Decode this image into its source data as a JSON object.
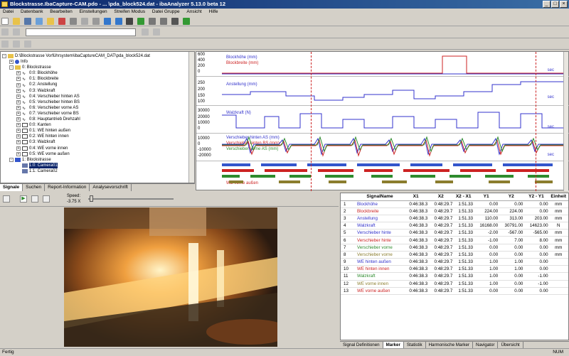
{
  "window": {
    "title": "Blockstrasse.IbaCapture-CAM.pdo - ... \\pda_block524.dat - ibaAnalyzer 5.13.0 beta 12"
  },
  "menu": [
    "Datei",
    "Datenbank",
    "Bearbeiten",
    "Einstellungen",
    "Streifen Modus",
    "Datei Gruppe",
    "Ansicht",
    "Hilfe"
  ],
  "tree": {
    "root": "D:\\Blockstrasse Vorführsystem\\ibaCaptureCAM_DAT\\pda_block524.dat",
    "items": [
      "Info",
      "0: Blockstrasse",
      "0:0: Blockhöhe",
      "0:1: Blockbreite",
      "0:2: Anstellung",
      "0:3: Walzkraft",
      "0:4: Verschieber hinten AS",
      "0:5: Verschieber hinten BS",
      "0:6: Verschieber vorne AS",
      "0:7: Verschieber vorne BS",
      "0:8: Hauptantrieb Drehzahl",
      "0:0: Kanten",
      "0:1: WE hinten außen",
      "0:2: WE hinten innen",
      "0:3: Walzkraft",
      "0:4: WE vorne innen",
      "0:5: WE vorne außen",
      "1: Blockstrasse",
      "1:0: Camera01",
      "1:1: Camera02"
    ]
  },
  "left_tabs": [
    "Signale",
    "Suchen",
    "Report-Information",
    "Analysevorschrift"
  ],
  "graphs": {
    "lanes": [
      {
        "y_ticks": [
          "600",
          "400",
          "200",
          "0"
        ],
        "signals": [
          "Blockhöhe (mm)",
          "Blockbreite (mm)"
        ],
        "unit": "sec"
      },
      {
        "y_ticks": [
          "250",
          "200",
          "150",
          "100"
        ],
        "signals": [
          "Anstellung (mm)"
        ],
        "unit": "sec"
      },
      {
        "y_ticks": [
          "30000",
          "20000",
          "10000",
          "0"
        ],
        "signals": [
          "Walzkraft (N)"
        ],
        "unit": "sec"
      },
      {
        "y_ticks": [
          "10000",
          "0",
          "-10000",
          "-20000"
        ],
        "signals": [
          "Verschieber hinten AS (mm)",
          "Verschieber hinten BS (mm)",
          "Verschieber vorne AS (mm)"
        ],
        "unit": "sec"
      },
      {
        "y_ticks": [],
        "signals": [
          "WE vorne außen"
        ],
        "unit": ""
      }
    ]
  },
  "player": {
    "speed_label": "Speed:",
    "speed_value": "-3.75 X"
  },
  "table": {
    "headers": [
      "",
      "SignalName",
      "X1",
      "X2",
      "X2 - X1",
      "Y1",
      "Y2",
      "Y2 - Y1",
      "Einheit"
    ],
    "rows": [
      [
        "1",
        "Blockhöhe",
        "0:46:38.3",
        "0:48:29.7",
        "1:51.33",
        "0.00",
        "0.00",
        "0.00",
        "mm",
        "#3333cc"
      ],
      [
        "2",
        "Blockbreite",
        "0:46:38.3",
        "0:48:29.7",
        "1:51.33",
        "224.00",
        "224.00",
        "0.00",
        "mm",
        "#cc2222"
      ],
      [
        "3",
        "Anstellung",
        "0:46:38.3",
        "0:48:29.7",
        "1:51.33",
        "110.00",
        "313.00",
        "203.00",
        "mm",
        "#3333cc"
      ],
      [
        "4",
        "Walzkraft",
        "0:46:38.3",
        "0:48:29.7",
        "1:51.33",
        "16168.00",
        "30791.00",
        "14623.00",
        "N",
        "#3333cc"
      ],
      [
        "5",
        "Verschieber hinte",
        "0:46:38.3",
        "0:48:29.7",
        "1:51.33",
        "-2.00",
        "-567.00",
        "-565.00",
        "mm",
        "#3333cc"
      ],
      [
        "6",
        "Verschieber hinte",
        "0:46:38.3",
        "0:48:29.7",
        "1:51.33",
        "-1.00",
        "7.00",
        "8.00",
        "mm",
        "#cc2222"
      ],
      [
        "7",
        "Verschieber vorne",
        "0:46:38.3",
        "0:48:29.7",
        "1:51.33",
        "0.00",
        "0.00",
        "0.00",
        "mm",
        "#2e8b2e"
      ],
      [
        "8",
        "Verschieber vorne",
        "0:46:38.3",
        "0:48:29.7",
        "1:51.33",
        "0.00",
        "0.00",
        "0.00",
        "mm",
        "#8b7d2e"
      ],
      [
        "9",
        "WE hinten außen",
        "0:46:38.3",
        "0:48:29.7",
        "1:51.33",
        "1.00",
        "1.00",
        "0.00",
        "",
        "#3333cc"
      ],
      [
        "10",
        "WE hinten innen",
        "0:46:38.3",
        "0:48:29.7",
        "1:51.33",
        "1.00",
        "1.00",
        "0.00",
        "",
        "#cc2222"
      ],
      [
        "11",
        "Walzkraft",
        "0:46:38.3",
        "0:48:29.7",
        "1:51.33",
        "1.00",
        "0.00",
        "-1.00",
        "",
        "#2e8b2e"
      ],
      [
        "12",
        "WE vorne innen",
        "0:46:38.3",
        "0:48:29.7",
        "1:51.33",
        "1.00",
        "0.00",
        "-1.00",
        "",
        "#8b7d2e"
      ],
      [
        "13",
        "WE vorne außen",
        "0:46:38.3",
        "0:48:29.7",
        "1:51.33",
        "0.00",
        "0.00",
        "0.00",
        "",
        "#cc2222"
      ]
    ]
  },
  "right_tabs": [
    "Signal Definitionen",
    "Marker",
    "Statistik",
    "Harmonische Marker",
    "Navigator",
    "Übersicht"
  ],
  "status": {
    "left": "Fertig",
    "right": "NUM"
  }
}
